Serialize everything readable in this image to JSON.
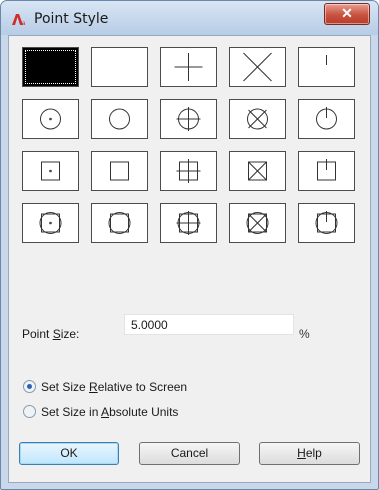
{
  "window": {
    "title": "Point Style",
    "close_glyph": "✕"
  },
  "point_styles": {
    "selected_index": 0,
    "rows": 4,
    "columns": 5,
    "cell_glyphs": [
      "none",
      "blank",
      "plus",
      "cross",
      "tick",
      "circle-dot",
      "circle",
      "circle-plus",
      "circle-cross",
      "circle-tick",
      "square-dot",
      "square",
      "square-plus",
      "square-cross",
      "square-tick",
      "circle-square-dot",
      "circle-square",
      "circle-square-plus",
      "circle-square-cross",
      "circle-square-tick"
    ]
  },
  "point_size": {
    "label_before": "Point ",
    "label_accel": "S",
    "label_after": "ize:",
    "value": "5.0000",
    "unit": "%"
  },
  "size_mode": {
    "options": [
      {
        "before": "Set Size ",
        "accel": "R",
        "after": "elative to Screen",
        "selected": true
      },
      {
        "before": "Set Size in ",
        "accel": "A",
        "after": "bsolute Units",
        "selected": false
      }
    ]
  },
  "buttons": {
    "ok": "OK",
    "cancel": "Cancel",
    "help_accel": "H",
    "help_rest": "elp"
  }
}
